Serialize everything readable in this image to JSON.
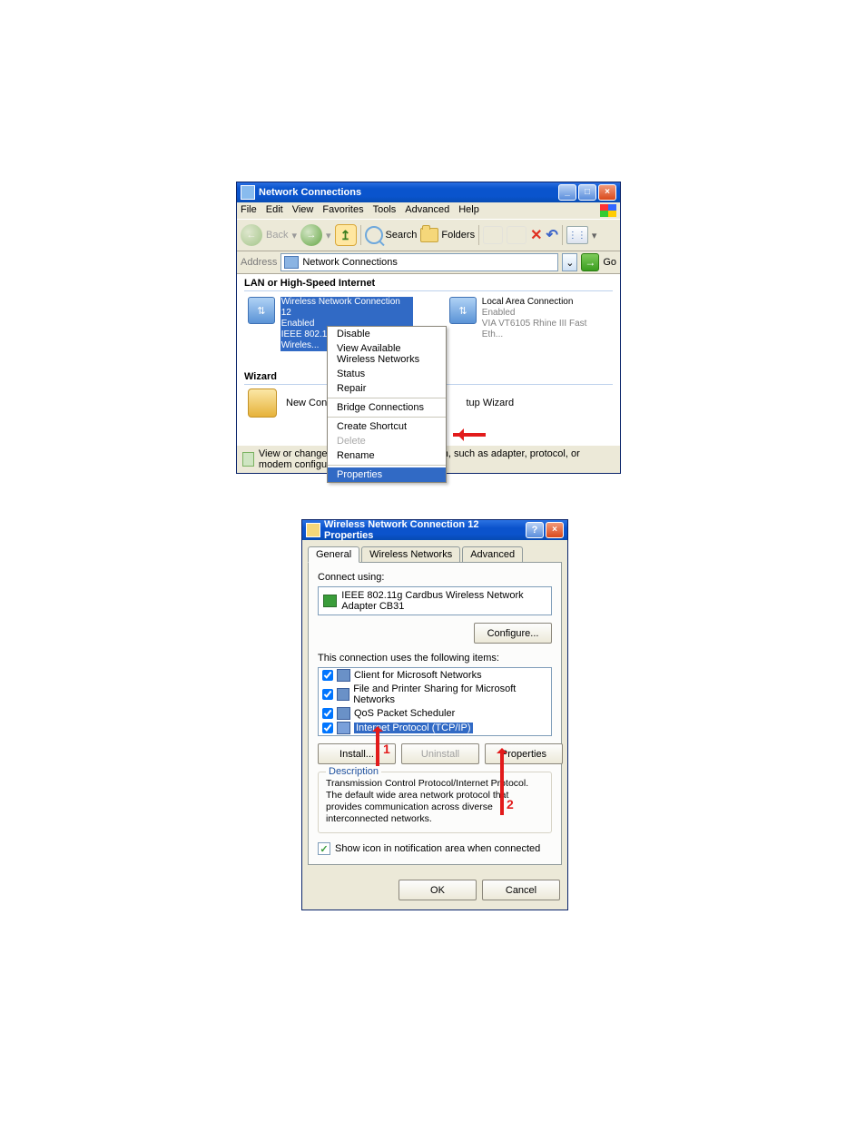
{
  "win1": {
    "title": "Network Connections",
    "menu": [
      "File",
      "Edit",
      "View",
      "Favorites",
      "Tools",
      "Advanced",
      "Help"
    ],
    "toolbar": {
      "back": "Back",
      "search": "Search",
      "folders": "Folders"
    },
    "address": {
      "label": "Address",
      "value": "Network Connections",
      "go": "Go"
    },
    "group_lan": "LAN or High-Speed Internet",
    "conn1": {
      "l1": "Wireless Network Connection 12",
      "l2": "Enabled",
      "l3": "IEEE 802.11g Cardbus Wireles..."
    },
    "conn2": {
      "l1": "Local Area Connection",
      "l2": "Enabled",
      "l3": "VIA VT6105 Rhine III Fast Eth..."
    },
    "group_wizard": "Wizard",
    "wizard_item": "New Connecti",
    "wizard_item2": "tup Wizard",
    "context": {
      "disable": "Disable",
      "view": "View Available Wireless Networks",
      "status": "Status",
      "repair": "Repair",
      "bridge": "Bridge Connections",
      "shortcut": "Create Shortcut",
      "delete": "Delete",
      "rename": "Rename",
      "properties": "Properties"
    },
    "status": "View or change settings for this connection, such as adapter, protocol, or modem configuration settings."
  },
  "win2": {
    "title": "Wireless Network Connection 12 Properties",
    "tabs": {
      "general": "General",
      "wireless": "Wireless Networks",
      "advanced": "Advanced"
    },
    "connect_using": "Connect using:",
    "adapter": "IEEE 802.11g Cardbus Wireless Network Adapter CB31",
    "configure": "Configure...",
    "items_label": "This connection uses the following items:",
    "items": {
      "i1": "Client for Microsoft Networks",
      "i2": "File and Printer Sharing for Microsoft Networks",
      "i3": "QoS Packet Scheduler",
      "i4": "Internet Protocol (TCP/IP)"
    },
    "install": "Install...",
    "uninstall": "Uninstall",
    "properties": "Properties",
    "desc_title": "Description",
    "desc": "Transmission Control Protocol/Internet Protocol. The default wide area network protocol that provides communication across diverse interconnected networks.",
    "show_icon": "Show icon in notification area when connected",
    "ok": "OK",
    "cancel": "Cancel",
    "ann1": "1",
    "ann2": "2"
  }
}
